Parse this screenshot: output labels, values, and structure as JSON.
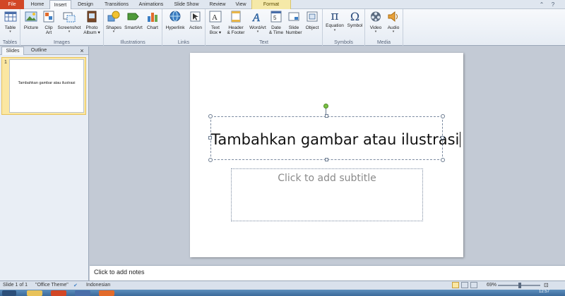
{
  "colors": {
    "file_tab": "#d24726",
    "format_tab": "#f5e9a8",
    "rotate_handle": "#7ac143",
    "thumb_selected": "#fbe7a2"
  },
  "tabs": {
    "file": "File",
    "home": "Home",
    "insert": "Insert",
    "design": "Design",
    "transitions": "Transitions",
    "animations": "Animations",
    "slideshow": "Slide Show",
    "review": "Review",
    "view": "View",
    "format": "Format"
  },
  "ribbon": {
    "tables": {
      "label": "Tables",
      "table": "Table"
    },
    "images": {
      "label": "Images",
      "picture": "Picture",
      "clipart_1": "Clip",
      "clipart_2": "Art",
      "screenshot": "Screenshot",
      "photoalbum_1": "Photo",
      "photoalbum_2": "Album"
    },
    "illustrations": {
      "label": "Illustrations",
      "shapes": "Shapes",
      "smartart": "SmartArt",
      "chart": "Chart"
    },
    "links": {
      "label": "Links",
      "hyperlink": "Hyperlink",
      "action": "Action"
    },
    "text": {
      "label": "Text",
      "textbox_1": "Text",
      "textbox_2": "Box",
      "header_1": "Header",
      "header_2": "& Footer",
      "wordart": "WordArt",
      "datetime_1": "Date",
      "datetime_2": "& Time",
      "slidenumber_1": "Slide",
      "slidenumber_2": "Number",
      "object": "Object"
    },
    "symbols": {
      "label": "Symbols",
      "equation": "Equation",
      "symbol": "Symbol"
    },
    "media": {
      "label": "Media",
      "video": "Video",
      "audio": "Audio"
    }
  },
  "left_pane": {
    "tab_slides": "Slides",
    "tab_outline": "Outline",
    "close": "×",
    "thumb_number": "1",
    "thumb_text": "Tambahkan gambar atau ilustrasi"
  },
  "slide": {
    "title": "Tambahkan gambar atau ilustrasi",
    "subtitle_placeholder": "Click to add subtitle"
  },
  "notes": {
    "placeholder": "Click to add notes"
  },
  "status": {
    "slide_of": "Slide 1 of 1",
    "theme": "\"Office Theme\"",
    "language": "Indonesian",
    "zoom": "69%",
    "time": "12:57"
  }
}
